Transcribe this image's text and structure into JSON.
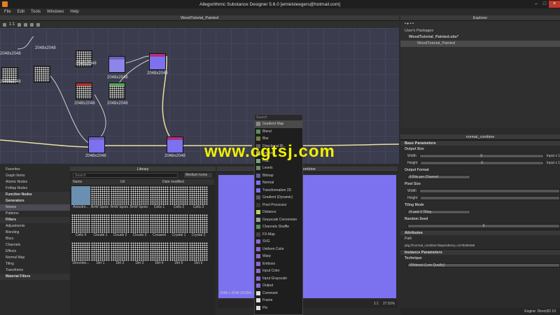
{
  "window": {
    "title": "Allegorithmic Substance Designer 5.6.0 [emielsleegers@hotmail.com]"
  },
  "menu": [
    "File",
    "Edit",
    "Tools",
    "Windows",
    "Help"
  ],
  "graph": {
    "title": "WoodTutorial_Painted",
    "zoom": "1:1",
    "node_labels": [
      "2048x2048",
      "2048x2048",
      "2048x2048",
      "2048x2048",
      "2048x2048",
      "2048x2048",
      "2048x2048",
      "2048x2048",
      "2048x2048",
      "2048x2048"
    ]
  },
  "explorer": {
    "title": "Explorer",
    "section": "User's Packages",
    "package": "WoodTutorial_Painted.sbs*",
    "graph": "WoodTutorial_Painted"
  },
  "attributes": {
    "node": "normal_combine",
    "base_params": "Base Parameters",
    "output_size": "Output Size",
    "width": "Width",
    "height": "Height",
    "width_val": "0",
    "height_val": "0",
    "inherit": "Input x 1",
    "output_format": "Output Format",
    "output_format_val": "8 Bits per Channel",
    "pixel_size": "Pixel Size",
    "tiling_mode": "Tiling Mode",
    "tiling_val": "H and V Tiling",
    "random_seed": "Random Seed",
    "random_val": "0",
    "attrs_head": "Attributes",
    "path": "Path",
    "path_val": "pkg:///normal_combine?dependency=1278286486",
    "instance": "Instance Parameters",
    "technique": "Technique",
    "technique_val": "Whiteout (Low Quality)"
  },
  "library": {
    "title": "Library",
    "search_placeholder": "Search",
    "size": "Medium Icons",
    "col_name": "Name",
    "col_url": "Url",
    "col_date": "Date modified",
    "sidebar": [
      {
        "label": "Favorites",
        "type": "item"
      },
      {
        "label": "Graph Items",
        "type": "item"
      },
      {
        "label": "Atomic Nodes",
        "type": "item"
      },
      {
        "label": "FxMap Nodes",
        "type": "item"
      },
      {
        "label": "Function Nodes",
        "type": "sec"
      },
      {
        "label": "Generators",
        "type": "sec"
      },
      {
        "label": "Noises",
        "type": "sel"
      },
      {
        "label": "Patterns",
        "type": "item"
      },
      {
        "label": "Filters",
        "type": "sec"
      },
      {
        "label": "Adjustments",
        "type": "item"
      },
      {
        "label": "Blending",
        "type": "item"
      },
      {
        "label": "Blurs",
        "type": "item"
      },
      {
        "label": "Channels",
        "type": "item"
      },
      {
        "label": "Effects",
        "type": "item"
      },
      {
        "label": "Normal Map",
        "type": "item"
      },
      {
        "label": "Tiling",
        "type": "item"
      },
      {
        "label": "Transforms",
        "type": "item"
      },
      {
        "label": "Material Filters",
        "type": "sec"
      }
    ],
    "thumbs": [
      "Anisotro...",
      "BnW Spots 1",
      "BnW Spots 2",
      "BnW Spots 3",
      "Cells 1",
      "Cells 2",
      "Cells 3",
      "Cells 4",
      "Clouds 1",
      "Clouds 2",
      "Clouds 3",
      "Creased",
      "Crystal 1",
      "Crystal 2",
      "Direction...",
      "Dirt 1",
      "Dirt 2",
      "Dirt 3",
      "Dirt 4",
      "Dirt 5",
      "Dirt 6"
    ]
  },
  "view2d": {
    "title": "combine",
    "info": "2048 x 2048 (RGBA, 16bpc)",
    "zoom": "27.91%",
    "ratio": "1:1"
  },
  "popup": {
    "search": "Search",
    "items": [
      {
        "label": "Gradient Map",
        "color": "#888888"
      },
      {
        "label": "Blend",
        "color": "#5a8f5a"
      },
      {
        "label": "Blur",
        "color": "#7a7a40"
      },
      {
        "label": "Directional Bl...",
        "color": "#5a5a5a"
      },
      {
        "label": "Emboss",
        "color": "#b0b050"
      },
      {
        "label": "HSL",
        "color": "#7a9f7a"
      },
      {
        "label": "Levels",
        "color": "#6a8a6a"
      },
      {
        "label": "Bitmap",
        "color": "#6b5a8f"
      },
      {
        "label": "Normal",
        "color": "#7c72f0"
      },
      {
        "label": "Transformation 2D",
        "color": "#7c72f0"
      },
      {
        "label": "Gradient (Dynamic)",
        "color": "#5a5a5a"
      },
      {
        "label": "Pixel Processor",
        "color": "#3a3a3a"
      },
      {
        "label": "Distance",
        "color": "#b8d06a"
      },
      {
        "label": "Grayscale Conversion",
        "color": "#9aa0a0"
      },
      {
        "label": "Channels Shuffle",
        "color": "#5a8f5a"
      },
      {
        "label": "FX-Map",
        "color": "#444444"
      },
      {
        "label": "SVG",
        "color": "#8a6ad0"
      },
      {
        "label": "Uniform Color",
        "color": "#8a6ad0"
      },
      {
        "label": "Warp",
        "color": "#8a6ad0"
      },
      {
        "label": "Emboss",
        "color": "#8a6ad0"
      },
      {
        "label": "Input Color",
        "color": "#8a6ad0"
      },
      {
        "label": "Input Grayscale",
        "color": "#8a6ad0"
      },
      {
        "label": "Output",
        "color": "#8a6ad0"
      },
      {
        "label": "Comment",
        "color": "#dddddd"
      },
      {
        "label": "Frame",
        "color": "#dddddd"
      },
      {
        "label": "Pin",
        "color": "#dddddd"
      }
    ]
  },
  "watermark": "www.cgtsj.com",
  "status": "Engine: Direct3D 10"
}
